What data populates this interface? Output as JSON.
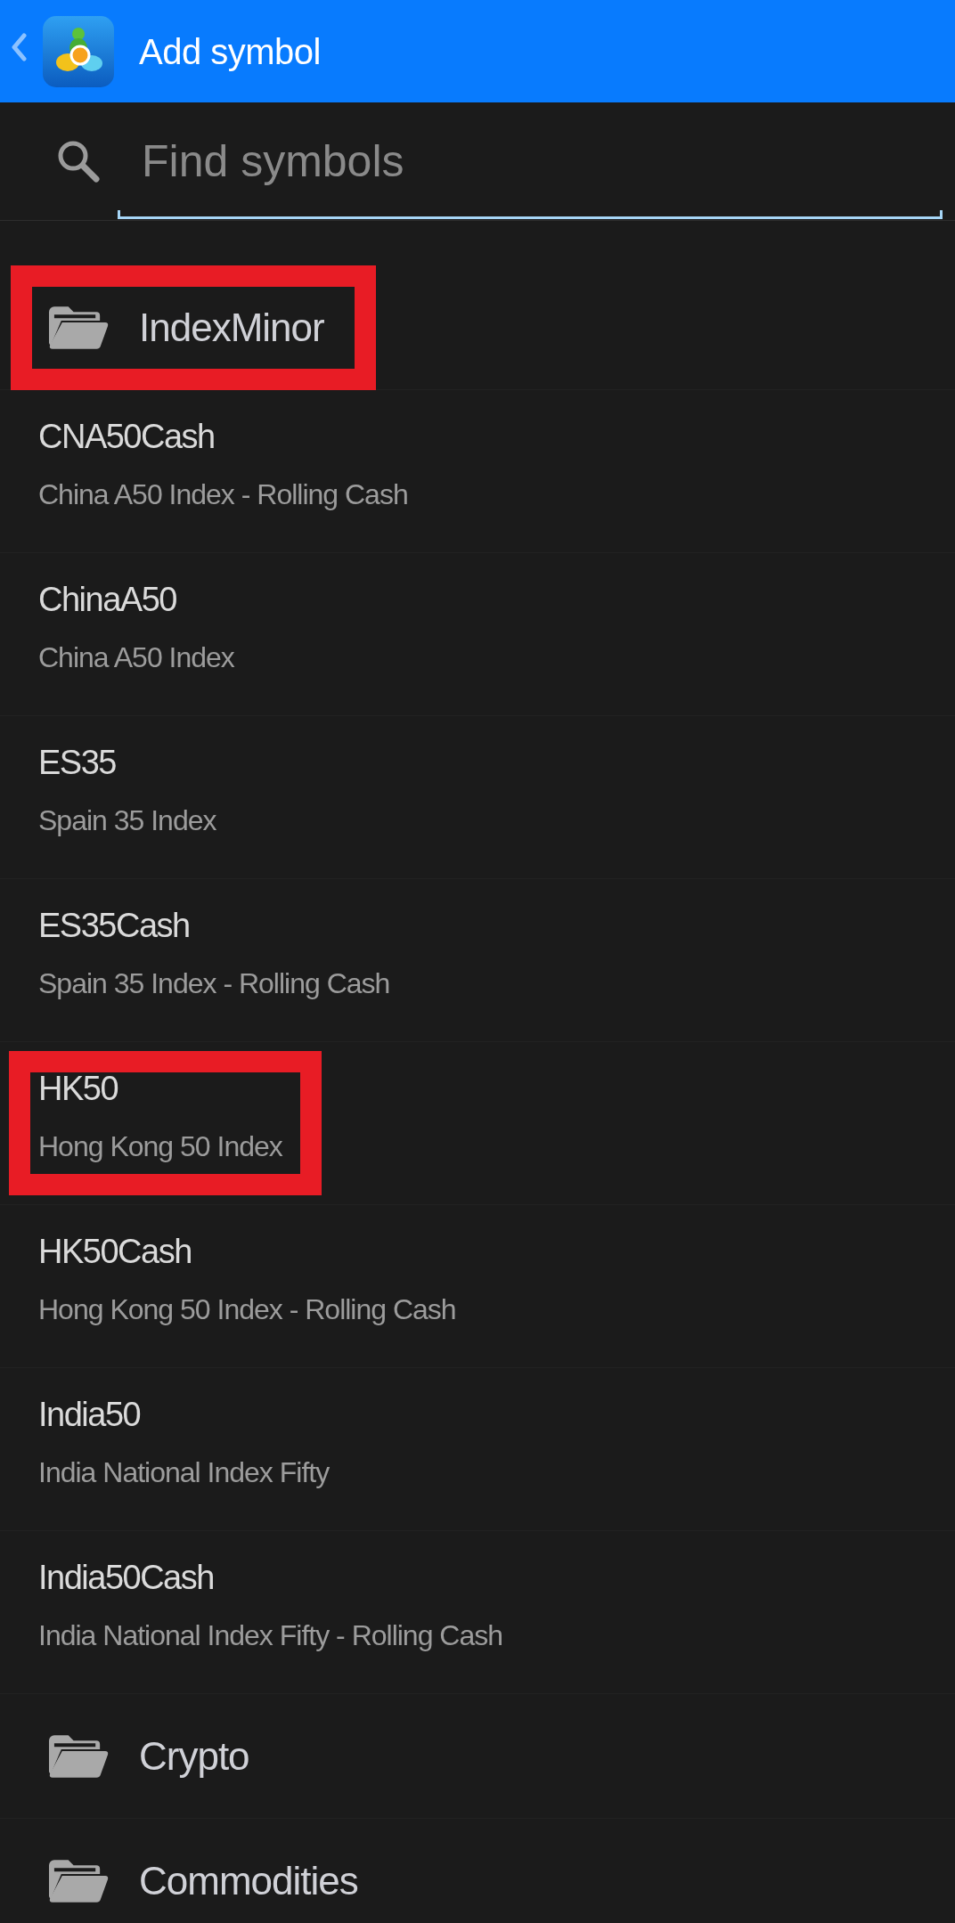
{
  "header": {
    "title": "Add symbol"
  },
  "search": {
    "placeholder": "Find symbols"
  },
  "list": [
    {
      "kind": "folder",
      "name": "IndexMinor",
      "highlighted": true
    },
    {
      "kind": "symbol",
      "symbol": "CNA50Cash",
      "description": "China A50 Index - Rolling Cash",
      "highlighted": false
    },
    {
      "kind": "symbol",
      "symbol": "ChinaA50",
      "description": "China A50 Index",
      "highlighted": false
    },
    {
      "kind": "symbol",
      "symbol": "ES35",
      "description": "Spain 35 Index",
      "highlighted": false
    },
    {
      "kind": "symbol",
      "symbol": "ES35Cash",
      "description": "Spain 35 Index - Rolling Cash",
      "highlighted": false
    },
    {
      "kind": "symbol",
      "symbol": "HK50",
      "description": "Hong Kong 50 Index",
      "highlighted": true
    },
    {
      "kind": "symbol",
      "symbol": "HK50Cash",
      "description": "Hong Kong 50 Index - Rolling Cash",
      "highlighted": false
    },
    {
      "kind": "symbol",
      "symbol": "India50",
      "description": "India National Index Fifty",
      "highlighted": false
    },
    {
      "kind": "symbol",
      "symbol": "India50Cash",
      "description": "India National Index Fifty - Rolling Cash",
      "highlighted": false
    },
    {
      "kind": "folder",
      "name": "Crypto",
      "highlighted": false
    },
    {
      "kind": "folder",
      "name": "Commodities",
      "highlighted": false
    }
  ]
}
